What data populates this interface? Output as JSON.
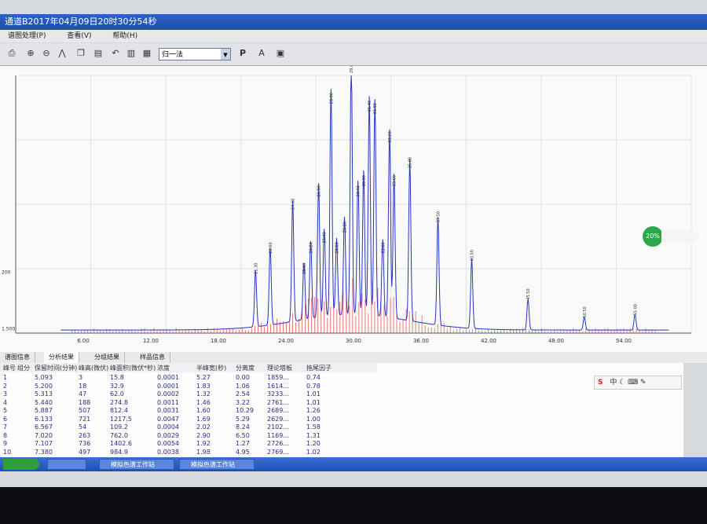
{
  "window": {
    "title": "通道B2017年04月09日20时30分54秒"
  },
  "menu": {
    "items": [
      "谱图处理(P)",
      "查看(V)",
      "帮助(H)"
    ]
  },
  "toolbar": {
    "method_value": "归一法",
    "p_button": "P",
    "a_button": "A"
  },
  "chart_data": {
    "type": "line",
    "xlim": [
      0,
      60
    ],
    "x_ticks": [
      "6.00",
      "12.00",
      "18.00",
      "24.00",
      "30.00",
      "36.00",
      "42.00",
      "48.00",
      "54.00"
    ],
    "y_ticks": [
      "1.500",
      "200"
    ],
    "peaks": [
      {
        "x": 21.3,
        "y": 0.22
      },
      {
        "x": 22.6,
        "y": 0.3
      },
      {
        "x": 24.6,
        "y": 0.47
      },
      {
        "x": 25.6,
        "y": 0.22
      },
      {
        "x": 26.2,
        "y": 0.3
      },
      {
        "x": 26.9,
        "y": 0.52
      },
      {
        "x": 27.4,
        "y": 0.34
      },
      {
        "x": 28.0,
        "y": 0.88
      },
      {
        "x": 28.5,
        "y": 0.3
      },
      {
        "x": 29.2,
        "y": 0.38
      },
      {
        "x": 29.8,
        "y": 1.0
      },
      {
        "x": 30.4,
        "y": 0.52
      },
      {
        "x": 30.9,
        "y": 0.56
      },
      {
        "x": 31.4,
        "y": 0.85
      },
      {
        "x": 31.9,
        "y": 0.84
      },
      {
        "x": 32.6,
        "y": 0.3
      },
      {
        "x": 33.2,
        "y": 0.73
      },
      {
        "x": 33.6,
        "y": 0.56
      },
      {
        "x": 35.0,
        "y": 0.63
      },
      {
        "x": 37.5,
        "y": 0.42
      },
      {
        "x": 40.5,
        "y": 0.27
      },
      {
        "x": 45.5,
        "y": 0.12
      },
      {
        "x": 50.5,
        "y": 0.05
      },
      {
        "x": 55.0,
        "y": 0.06
      }
    ]
  },
  "tabs": [
    "谱图信息",
    "分析结果",
    "分组结果",
    "样品信息"
  ],
  "table": {
    "headers": [
      "峰号",
      "组分",
      "保留时间(分钟)",
      "峰高(微伏)",
      "峰面积(微伏*秒)",
      "浓度",
      "半峰宽(秒)",
      "分离度",
      "理论塔板",
      "拖尾因子"
    ],
    "rows": [
      [
        "1",
        "",
        "5.093",
        "3",
        "15.8",
        "0.0001",
        "5.27",
        "0.00",
        "1859...",
        "0.74"
      ],
      [
        "2",
        "",
        "5.200",
        "18",
        "32.9",
        "0.0001",
        "1.83",
        "1.06",
        "1614...",
        "0.78"
      ],
      [
        "3",
        "",
        "5.313",
        "47",
        "62.0",
        "0.0002",
        "1.32",
        "2.54",
        "3233...",
        "1.01"
      ],
      [
        "4",
        "",
        "5.440",
        "188",
        "274.8",
        "0.0011",
        "1.46",
        "3.22",
        "2761...",
        "1.01"
      ],
      [
        "5",
        "",
        "5.887",
        "507",
        "812.4",
        "0.0031",
        "1.60",
        "10.29",
        "2689...",
        "1.26"
      ],
      [
        "6",
        "",
        "6.133",
        "721",
        "1217.5",
        "0.0047",
        "1.69",
        "5.29",
        "2629...",
        "1.00"
      ],
      [
        "7",
        "",
        "6.567",
        "54",
        "109.2",
        "0.0004",
        "2.02",
        "8.24",
        "2102...",
        "1.58"
      ],
      [
        "8",
        "",
        "7.020",
        "263",
        "762.0",
        "0.0029",
        "2.90",
        "6.50",
        "1169...",
        "1.31"
      ],
      [
        "9",
        "",
        "7.107",
        "736",
        "1402.6",
        "0.0054",
        "1.92",
        "1.27",
        "2726...",
        "1.20"
      ],
      [
        "10",
        "",
        "7.380",
        "497",
        "984.9",
        "0.0038",
        "1.98",
        "4.95",
        "2769...",
        "1.02"
      ]
    ]
  },
  "taskbar": {
    "tasks": [
      "",
      "模拟色谱工作站",
      "模拟色谱工作站"
    ]
  },
  "monitor_badge": {
    "percent": "20%"
  },
  "colors": {
    "trace": "#2633c4",
    "peak_fill": "#e06060",
    "titlebar": "#2357bd"
  }
}
